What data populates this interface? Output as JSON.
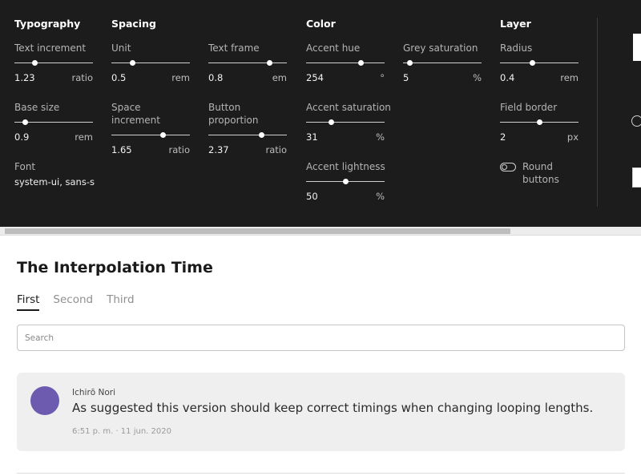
{
  "panel": {
    "groups": {
      "typography": "Typography",
      "spacing": "Spacing",
      "color": "Color",
      "layer": "Layer"
    },
    "controls": {
      "text_increment": {
        "label": "Text increment",
        "value": "1.23",
        "unit": "ratio",
        "fill": 0.26
      },
      "base_size": {
        "label": "Base size",
        "value": "0.9",
        "unit": "rem",
        "fill": 0.13
      },
      "font": {
        "label": "Font",
        "value": "system-ui, sans-s"
      },
      "unit": {
        "label": "Unit",
        "value": "0.5",
        "unit": "rem",
        "fill": 0.27
      },
      "space_increment": {
        "label": "Space increment",
        "value": "1.65",
        "unit": "ratio",
        "fill": 0.65
      },
      "text_frame": {
        "label": "Text frame",
        "value": "0.8",
        "unit": "em",
        "fill": 0.78
      },
      "button_proportion": {
        "label": "Button proportion",
        "value": "2.37",
        "unit": "ratio",
        "fill": 0.67
      },
      "accent_hue": {
        "label": "Accent hue",
        "value": "254",
        "unit": "°",
        "fill": 0.69
      },
      "accent_saturation": {
        "label": "Accent saturation",
        "value": "31",
        "unit": "%",
        "fill": 0.32
      },
      "accent_lightness": {
        "label": "Accent lightness",
        "value": "50",
        "unit": "%",
        "fill": 0.5
      },
      "grey_saturation": {
        "label": "Grey saturation",
        "value": "5",
        "unit": "%",
        "fill": 0.08
      },
      "radius": {
        "label": "Radius",
        "value": "0.4",
        "unit": "rem",
        "fill": 0.41
      },
      "field_border": {
        "label": "Field border",
        "value": "2",
        "unit": "px",
        "fill": 0.5
      },
      "round_buttons": {
        "label": "Round buttons",
        "checked": false
      }
    }
  },
  "main": {
    "title": "The Interpolation Time",
    "tabs": [
      "First",
      "Second",
      "Third"
    ],
    "active_tab": 0,
    "search": {
      "placeholder": "Search",
      "value": ""
    },
    "comment": {
      "author": "Ichirō Nori",
      "text": "As suggested this version should keep correct timings when changing looping lengths.",
      "meta": "6:51 p. m. · 11 jun. 2020",
      "avatar_color": "#6d5bb0"
    }
  },
  "colors": {
    "panel_bg": "#1c1c1c",
    "accent": "#6d5bb0",
    "card_bg": "#efeff0"
  }
}
